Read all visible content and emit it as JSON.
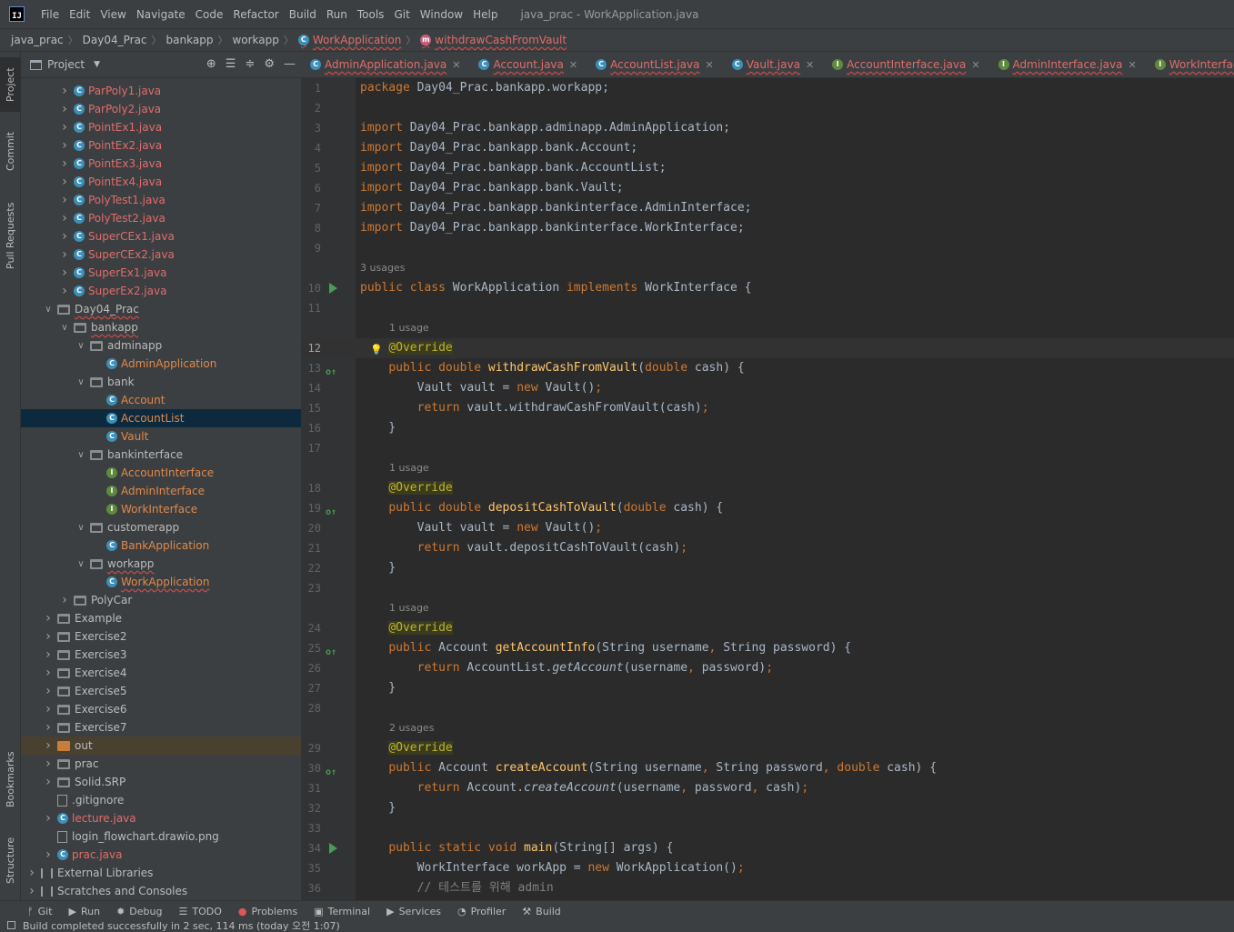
{
  "menubar": {
    "items": [
      "File",
      "Edit",
      "View",
      "Navigate",
      "Code",
      "Refactor",
      "Build",
      "Run",
      "Tools",
      "Git",
      "Window",
      "Help"
    ],
    "window_title": "java_prac - WorkApplication.java"
  },
  "breadcrumb": [
    "java_prac",
    "Day04_Prac",
    "bankapp",
    "workapp",
    "WorkApplication",
    "withdrawCashFromVault"
  ],
  "left_stripe": {
    "project": "Project",
    "commit": "Commit",
    "pull_requests": "Pull Requests",
    "bookmarks": "Bookmarks",
    "structure": "Structure"
  },
  "project_panel": {
    "title": "Project",
    "tree": [
      {
        "label": "ParPoly1.java",
        "kind": "class",
        "color": "red",
        "indent": 1
      },
      {
        "label": "ParPoly2.java",
        "kind": "class",
        "color": "red",
        "indent": 1
      },
      {
        "label": "PointEx1.java",
        "kind": "class",
        "color": "red",
        "indent": 1
      },
      {
        "label": "PointEx2.java",
        "kind": "class",
        "color": "red",
        "indent": 1
      },
      {
        "label": "PointEx3.java",
        "kind": "class",
        "color": "red",
        "indent": 1
      },
      {
        "label": "PointEx4.java",
        "kind": "class",
        "color": "red",
        "indent": 1
      },
      {
        "label": "PolyTest1.java",
        "kind": "class",
        "color": "red",
        "indent": 1
      },
      {
        "label": "PolyTest2.java",
        "kind": "class",
        "color": "red",
        "indent": 1
      },
      {
        "label": "SuperCEx1.java",
        "kind": "class",
        "color": "red",
        "indent": 1
      },
      {
        "label": "SuperCEx2.java",
        "kind": "class",
        "color": "red",
        "indent": 1
      },
      {
        "label": "SuperEx1.java",
        "kind": "class",
        "color": "red",
        "indent": 1
      },
      {
        "label": "SuperEx2.java",
        "kind": "class",
        "color": "red",
        "indent": 1
      },
      {
        "label": "Day04_Prac",
        "kind": "folder-open",
        "color": "normal",
        "indent": 0,
        "wavy": true
      },
      {
        "label": "bankapp",
        "kind": "folder-open",
        "color": "normal",
        "indent": 1,
        "wavy": true
      },
      {
        "label": "adminapp",
        "kind": "folder-open",
        "color": "normal",
        "indent": 2
      },
      {
        "label": "AdminApplication",
        "kind": "class-leaf",
        "color": "orange",
        "indent": 3
      },
      {
        "label": "bank",
        "kind": "folder-open",
        "color": "normal",
        "indent": 2
      },
      {
        "label": "Account",
        "kind": "class-leaf",
        "color": "orange",
        "indent": 3
      },
      {
        "label": "AccountList",
        "kind": "class-leaf",
        "color": "orange",
        "indent": 3,
        "selected": true
      },
      {
        "label": "Vault",
        "kind": "class-leaf",
        "color": "orange",
        "indent": 3
      },
      {
        "label": "bankinterface",
        "kind": "folder-open",
        "color": "normal",
        "indent": 2
      },
      {
        "label": "AccountInterface",
        "kind": "iface-leaf",
        "color": "orange",
        "indent": 3
      },
      {
        "label": "AdminInterface",
        "kind": "iface-leaf",
        "color": "orange",
        "indent": 3
      },
      {
        "label": "WorkInterface",
        "kind": "iface-leaf",
        "color": "orange",
        "indent": 3
      },
      {
        "label": "customerapp",
        "kind": "folder-open",
        "color": "normal",
        "indent": 2
      },
      {
        "label": "BankApplication",
        "kind": "run-leaf",
        "color": "orange",
        "indent": 3
      },
      {
        "label": "workapp",
        "kind": "folder-open",
        "color": "normal",
        "indent": 2,
        "wavy": true
      },
      {
        "label": "WorkApplication",
        "kind": "run-leaf",
        "color": "orange",
        "indent": 3,
        "wavy": true
      },
      {
        "label": "PolyCar",
        "kind": "folder",
        "color": "normal",
        "indent": 1
      },
      {
        "label": "Example",
        "kind": "folder",
        "color": "normal",
        "indent": 0
      },
      {
        "label": "Exercise2",
        "kind": "folder",
        "color": "normal",
        "indent": 0
      },
      {
        "label": "Exercise3",
        "kind": "folder",
        "color": "normal",
        "indent": 0
      },
      {
        "label": "Exercise4",
        "kind": "folder",
        "color": "normal",
        "indent": 0
      },
      {
        "label": "Exercise5",
        "kind": "folder",
        "color": "normal",
        "indent": 0
      },
      {
        "label": "Exercise6",
        "kind": "folder",
        "color": "normal",
        "indent": 0
      },
      {
        "label": "Exercise7",
        "kind": "folder",
        "color": "normal",
        "indent": 0
      },
      {
        "label": "out",
        "kind": "folder-orange",
        "color": "normal",
        "indent": 0,
        "highlight": true
      },
      {
        "label": "prac",
        "kind": "folder",
        "color": "normal",
        "indent": 0
      },
      {
        "label": "Solid.SRP",
        "kind": "folder",
        "color": "normal",
        "indent": 0
      },
      {
        "label": ".gitignore",
        "kind": "file",
        "color": "normal",
        "indent": 0
      },
      {
        "label": "lecture.java",
        "kind": "class",
        "color": "red",
        "indent": 0
      },
      {
        "label": "login_flowchart.drawio.png",
        "kind": "file",
        "color": "normal",
        "indent": 0
      },
      {
        "label": "prac.java",
        "kind": "run",
        "color": "red",
        "indent": 0
      },
      {
        "label": "External Libraries",
        "kind": "lib",
        "color": "normal",
        "indent": -1
      },
      {
        "label": "Scratches and Consoles",
        "kind": "scratch",
        "color": "normal",
        "indent": -1
      }
    ]
  },
  "tabs": [
    {
      "label": "AdminApplication.java",
      "kind": "class"
    },
    {
      "label": "Account.java",
      "kind": "class"
    },
    {
      "label": "AccountList.java",
      "kind": "class"
    },
    {
      "label": "Vault.java",
      "kind": "class"
    },
    {
      "label": "AccountInterface.java",
      "kind": "iface"
    },
    {
      "label": "AdminInterface.java",
      "kind": "iface"
    },
    {
      "label": "WorkInterface.java",
      "kind": "iface"
    }
  ],
  "editor": {
    "lines": [
      {
        "n": "1",
        "html": "<span class='kw'>package</span> Day04_Prac.bankapp.workapp;"
      },
      {
        "n": "2",
        "html": ""
      },
      {
        "n": "3",
        "html": "<span class='kw'>import</span> Day04_Prac.bankapp.adminapp.AdminApplication;"
      },
      {
        "n": "4",
        "html": "<span class='kw'>import</span> Day04_Prac.bankapp.bank.Account;"
      },
      {
        "n": "5",
        "html": "<span class='kw'>import</span> Day04_Prac.bankapp.bank.AccountList;"
      },
      {
        "n": "6",
        "html": "<span class='kw'>import</span> Day04_Prac.bankapp.bank.Vault;"
      },
      {
        "n": "7",
        "html": "<span class='kw'>import</span> Day04_Prac.bankapp.bankinterface.AdminInterface;"
      },
      {
        "n": "8",
        "html": "<span class='kw'>import</span> Day04_Prac.bankapp.bankinterface.WorkInterface;"
      },
      {
        "n": "9",
        "html": ""
      },
      {
        "hint": "3 usages"
      },
      {
        "n": "10",
        "run": true,
        "html": "<span class='kw'>public class</span> WorkApplication <span class='kw'>implements</span> WorkInterface {"
      },
      {
        "n": "11",
        "html": ""
      },
      {
        "hint": "1 usage",
        "indent": 1
      },
      {
        "n": "12",
        "cur": true,
        "bulb": true,
        "html": "    <span class='ann'>@Override</span>"
      },
      {
        "n": "13",
        "impl": true,
        "html": "    <span class='kw'>public double</span> <span class='fn'>withdrawCashFromVault</span>(<span class='kw'>double</span> cash) {"
      },
      {
        "n": "14",
        "html": "        Vault vault = <span class='kw'>new</span> Vault()<span class='kw'>;</span>"
      },
      {
        "n": "15",
        "html": "        <span class='kw'>return</span> vault.withdrawCashFromVault(cash)<span class='kw'>;</span>"
      },
      {
        "n": "16",
        "html": "    }"
      },
      {
        "n": "17",
        "html": ""
      },
      {
        "hint": "1 usage",
        "indent": 1
      },
      {
        "n": "18",
        "html": "    <span class='ann'>@Override</span>"
      },
      {
        "n": "19",
        "impl": true,
        "html": "    <span class='kw'>public double</span> <span class='fn'>depositCashToVault</span>(<span class='kw'>double</span> cash) {"
      },
      {
        "n": "20",
        "html": "        Vault vault = <span class='kw'>new</span> Vault()<span class='kw'>;</span>"
      },
      {
        "n": "21",
        "html": "        <span class='kw'>return</span> vault.depositCashToVault(cash)<span class='kw'>;</span>"
      },
      {
        "n": "22",
        "html": "    }"
      },
      {
        "n": "23",
        "html": ""
      },
      {
        "hint": "1 usage",
        "indent": 1
      },
      {
        "n": "24",
        "html": "    <span class='ann'>@Override</span>"
      },
      {
        "n": "25",
        "impl": true,
        "html": "    <span class='kw'>public</span> Account <span class='fn'>getAccountInfo</span>(String username<span class='kw'>,</span> String password) {"
      },
      {
        "n": "26",
        "html": "        <span class='kw'>return</span> AccountList.<span class='it'>getAccount</span>(username<span class='kw'>,</span> password)<span class='kw'>;</span>"
      },
      {
        "n": "27",
        "html": "    }"
      },
      {
        "n": "28",
        "html": ""
      },
      {
        "hint": "2 usages",
        "indent": 1
      },
      {
        "n": "29",
        "html": "    <span class='ann'>@Override</span>"
      },
      {
        "n": "30",
        "impl": true,
        "html": "    <span class='kw'>public</span> Account <span class='fn'>createAccount</span>(String username<span class='kw'>,</span> String password<span class='kw'>, double</span> cash) {"
      },
      {
        "n": "31",
        "html": "        <span class='kw'>return</span> Account.<span class='it'>createAccount</span>(username<span class='kw'>,</span> password<span class='kw'>,</span> cash)<span class='kw'>;</span>"
      },
      {
        "n": "32",
        "html": "    }"
      },
      {
        "n": "33",
        "html": ""
      },
      {
        "n": "34",
        "run": true,
        "html": "    <span class='kw'>public static void</span> <span class='fn'>main</span>(String[] args) {"
      },
      {
        "n": "35",
        "html": "        WorkInterface workApp = <span class='kw'>new</span> WorkApplication()<span class='kw'>;</span>"
      },
      {
        "n": "36",
        "html": "        <span class='cm'>// 테스트를 위해 admin</span>"
      }
    ]
  },
  "bottom_tools": [
    {
      "icon": "git-icon",
      "glyph": "ᚠ",
      "label": "Git"
    },
    {
      "icon": "run-icon",
      "glyph": "▶",
      "label": "Run"
    },
    {
      "icon": "debug-icon",
      "glyph": "✹",
      "label": "Debug"
    },
    {
      "icon": "todo-icon",
      "glyph": "☰",
      "label": "TODO"
    },
    {
      "icon": "problems-icon",
      "glyph": "●",
      "label": "Problems"
    },
    {
      "icon": "terminal-icon",
      "glyph": "▣",
      "label": "Terminal"
    },
    {
      "icon": "services-icon",
      "glyph": "▶",
      "label": "Services"
    },
    {
      "icon": "profiler-icon",
      "glyph": "◔",
      "label": "Profiler"
    },
    {
      "icon": "build-icon",
      "glyph": "⚒",
      "label": "Build"
    }
  ],
  "status": "Build completed successfully in 2 sec, 114 ms (today 오전 1:07)"
}
